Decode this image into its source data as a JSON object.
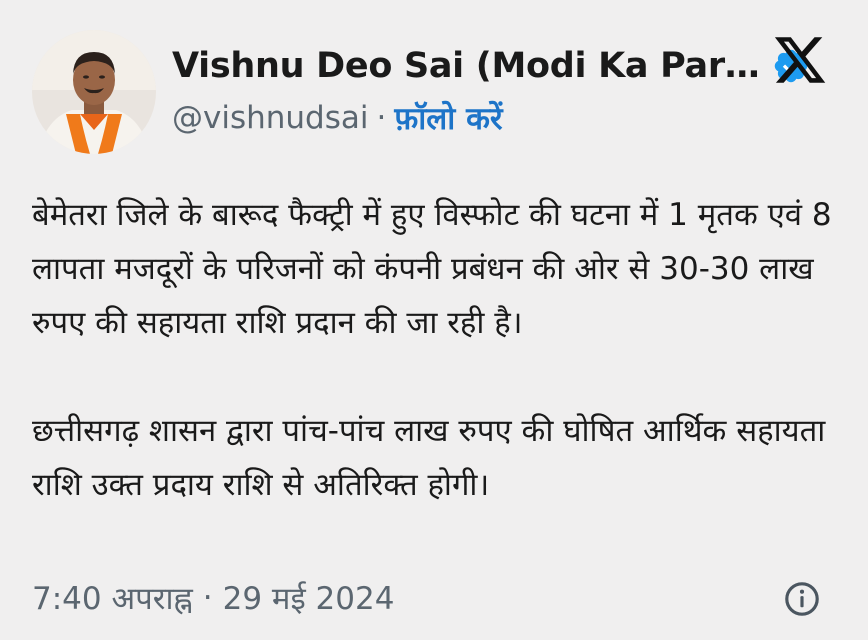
{
  "tweet": {
    "author": {
      "display_name": "Vishnu Deo Sai (Modi Ka Par…",
      "handle": "@vishnudsai",
      "separator": "·",
      "follow_label": "फ़ॉलो करें",
      "verified": true,
      "avatar_icon": "profile-photo"
    },
    "paragraphs": [
      "बेमेतरा जिले के बारूद फैक्ट्री में हुए विस्फोट की घटना में  1 मृतक एवं 8 लापता मजदूरों के परिजनों को कंपनी प्रबंधन की ओर से 30-30 लाख रुपए की सहायता राशि प्रदान की जा रही है।",
      "छत्तीसगढ़ शासन द्वारा पांच-पांच लाख रुपए की घोषित आर्थिक सहायता राशि उक्त प्रदाय राशि से अतिरिक्त होगी।"
    ],
    "time": "7:40 अपराह्न",
    "meta_separator": "·",
    "date": "29 मई 2024"
  },
  "icons": {
    "platform_logo": "x-logo-icon",
    "verified_badge": "verified-badge-icon",
    "info": "info-icon"
  },
  "colors": {
    "background": "#f0efef",
    "text": "#1a1a1a",
    "secondary_text": "#5b6670",
    "follow_link": "#1d74c8",
    "verified_badge": "#1d9bf0"
  }
}
